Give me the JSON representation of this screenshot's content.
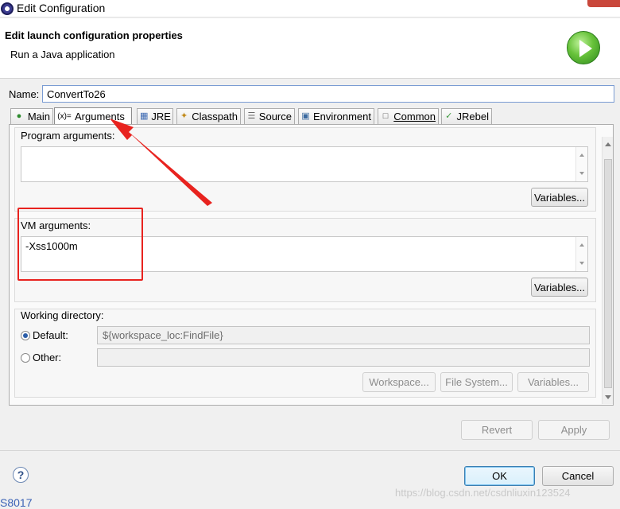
{
  "window": {
    "title": "Edit Configuration"
  },
  "header": {
    "title": "Edit launch configuration properties",
    "subtitle": "Run a Java application",
    "icon": "run-icon"
  },
  "name_field": {
    "label": "Name:",
    "value": "ConvertTo26"
  },
  "tabs": [
    {
      "label": "Main",
      "icon": "main-tab-icon",
      "active": false
    },
    {
      "label": "Arguments",
      "icon": "arguments-tab-icon",
      "active": true
    },
    {
      "label": "JRE",
      "icon": "jre-tab-icon",
      "active": false
    },
    {
      "label": "Classpath",
      "icon": "classpath-tab-icon",
      "active": false
    },
    {
      "label": "Source",
      "icon": "source-tab-icon",
      "active": false
    },
    {
      "label": "Environment",
      "icon": "environment-tab-icon",
      "active": false
    },
    {
      "label": "Common",
      "icon": "common-tab-icon",
      "active": false
    },
    {
      "label": "JRebel",
      "icon": "jrebel-tab-icon",
      "active": false
    }
  ],
  "program_arguments": {
    "label": "Program arguments:",
    "value": "",
    "variables_button": "Variables..."
  },
  "vm_arguments": {
    "label": "VM arguments:",
    "value": "-Xss1000m",
    "variables_button": "Variables..."
  },
  "working_directory": {
    "label": "Working directory:",
    "default_label": "Default:",
    "default_selected": true,
    "default_value": "${workspace_loc:FindFile}",
    "other_label": "Other:",
    "other_value": "",
    "buttons": {
      "workspace": "Workspace...",
      "file_system": "File System...",
      "variables": "Variables..."
    }
  },
  "actions": {
    "revert": "Revert",
    "apply": "Apply"
  },
  "footer": {
    "ok": "OK",
    "cancel": "Cancel"
  },
  "overlay": {
    "watermark": "https://blog.csdn.net/csdnliuxin123524",
    "stray_text": "S8017",
    "annotation_color": "#e8231f"
  },
  "colors": {
    "accent": "#3c7fb1",
    "annotation": "#e8231f"
  }
}
